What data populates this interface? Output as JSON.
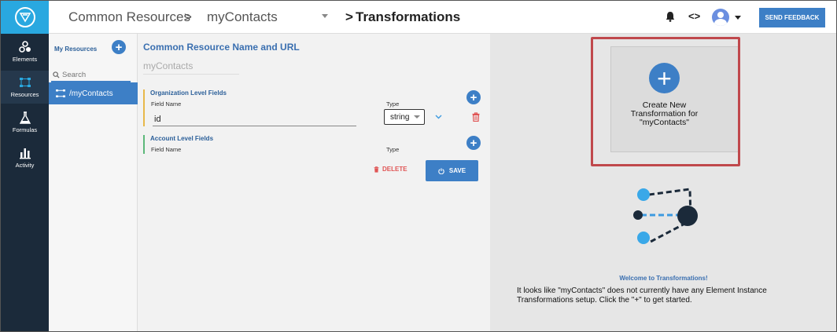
{
  "nav": {
    "items": [
      {
        "label": "Elements"
      },
      {
        "label": "Resources"
      },
      {
        "label": "Formulas"
      },
      {
        "label": "Activity"
      }
    ]
  },
  "header": {
    "breadcrumb": [
      "Common Resources",
      "myContacts"
    ],
    "separator": ">",
    "title": "Transformations",
    "feedback_label": "SEND FEEDBACK"
  },
  "resources": {
    "heading": "My Resources",
    "search_placeholder": "Search",
    "items": [
      {
        "label": "/myContacts"
      }
    ]
  },
  "editor": {
    "title": "Common Resource Name and URL",
    "name_value": "myContacts",
    "org_section": {
      "title": "Organization Level Fields",
      "field_name_label": "Field Name",
      "type_label": "Type",
      "field_value": "id",
      "type_value": "string"
    },
    "account_section": {
      "title": "Account Level Fields",
      "field_name_label": "Field Name",
      "type_label": "Type"
    },
    "delete_label": "DELETE",
    "save_label": "SAVE"
  },
  "transformations": {
    "create_text": "Create New\nTransformation for\n\"myContacts\"",
    "welcome_title": "Welcome to Transformations!",
    "welcome_body": "It looks like \"myContacts\" does not currently have any Element Instance Transformations setup. Click the \"+\" to get started."
  },
  "colors": {
    "accent": "#3d7fc6",
    "nav_bg": "#1b2a3a",
    "logo_bg": "#29a8e0",
    "highlight": "#c0484c",
    "danger": "#e05555"
  }
}
